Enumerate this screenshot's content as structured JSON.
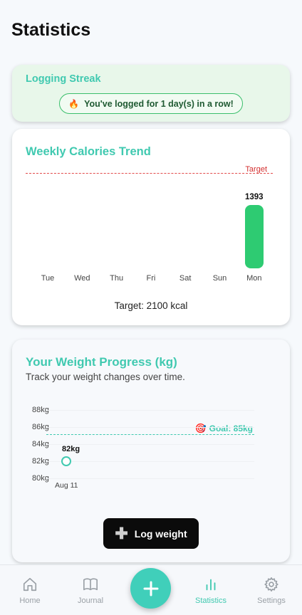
{
  "page": {
    "title": "Statistics"
  },
  "streak": {
    "title": "Logging Streak",
    "icon": "fire-icon",
    "message": "You've logged for 1 day(s) in a row!"
  },
  "calories": {
    "title": "Weekly Calories Trend",
    "target_marker_label": "Target",
    "target_text": "Target: 2100 kcal"
  },
  "weight": {
    "title": "Your Weight Progress (kg)",
    "subtitle": "Track your weight changes over time.",
    "goal_icon": "target-icon",
    "goal_label": "Goal: 85kg",
    "log_button_label": "Log weight",
    "log_button_icon": "plus-icon"
  },
  "nav": {
    "items": [
      {
        "label": "Home",
        "icon": "home-icon"
      },
      {
        "label": "Journal",
        "icon": "book-icon"
      },
      {
        "label": "Statistics",
        "icon": "bar-chart-icon",
        "active": true
      },
      {
        "label": "Settings",
        "icon": "gear-icon"
      }
    ],
    "fab_icon": "plus-icon"
  },
  "colors": {
    "accent": "#40c9b0",
    "bar": "#2ecb72",
    "target_line": "#e24a4a",
    "streak_bg": "#e8f7ea"
  },
  "chart_data": [
    {
      "type": "bar",
      "categories": [
        "Tue",
        "Wed",
        "Thu",
        "Fri",
        "Sat",
        "Sun",
        "Mon"
      ],
      "values": [
        0,
        0,
        0,
        0,
        0,
        0,
        1393
      ],
      "value_labels": [
        "",
        "",
        "",
        "",
        "",
        "",
        "1393"
      ],
      "target": 2100,
      "target_label": "Target",
      "title": "Weekly Calories Trend",
      "ylim": [
        0,
        2100
      ],
      "grid": false
    },
    {
      "type": "line",
      "title": "Your Weight Progress (kg)",
      "x": [
        "Aug 11"
      ],
      "series": [
        {
          "values": [
            82
          ],
          "value_labels": [
            "82kg"
          ]
        }
      ],
      "y_ticks": [
        "88kg",
        "86kg",
        "84kg",
        "82kg",
        "80kg"
      ],
      "y_tick_values": [
        88,
        86,
        84,
        82,
        80
      ],
      "ylim": [
        80,
        88
      ],
      "goal": 85,
      "goal_label": "Goal: 85kg",
      "grid": true
    }
  ]
}
